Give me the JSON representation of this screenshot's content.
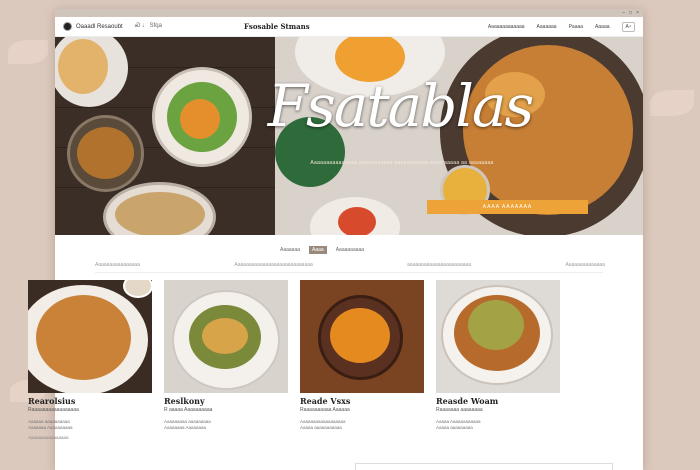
{
  "browser": {
    "controls": [
      "–",
      "□",
      "×"
    ]
  },
  "nav": {
    "brand": "Oaaadl Resaoubt",
    "brand_extra": "Ꮝ ♩ Sfqa",
    "title": "Fsosable Stmans",
    "links": [
      "Aaaaaaaaaaaaa",
      "Aaaaaaa",
      "Paaaa",
      "Aaaaa"
    ],
    "button": "A⁴"
  },
  "hero": {
    "title": "Fsatablas",
    "subtitle": "Aaaaaaaaaaaaaaa aaaaaaaaaaa aaaaaaaaaaa aaaa aaaaa aa aaaaaaaa",
    "cta": "AAAA   AAAAAAA"
  },
  "section": {
    "tabs": [
      "Aaaaaaa",
      "Aaaa",
      "Aaaaaaaaaa"
    ],
    "active_tab": 1,
    "tagline": [
      "Aaaaaaaaaaaaaaaa",
      "Aaaaaaaaaaaaaaaaaaaaaaaaaaaa",
      "aaaaaaaaaaaaaaaaaaaaaaa",
      "Aaaaaaaaaaaaaa"
    ]
  },
  "cards": [
    {
      "title": "Rearolsius",
      "sub": "Raaaaaaaaaaaaaaaaa",
      "desc": "Aaaaaa aaaaaaaaaa\nAaaaaaa Aaaaaaaaaa",
      "link": "Aaaaaaaaaaaaaaaa"
    },
    {
      "title": "Reslkony",
      "sub": "R aaaaa Aaaaaaaaaa",
      "desc": "Aaaaaaaaa aaaaaaaaa\nAaaaaaaa Aaaaaaaa",
      "link": ""
    },
    {
      "title": "Reade Vsxs",
      "sub": "Raaaaaaaaaa Aaaaaa",
      "desc": "Aaaaaaaaaaaaaaaaaa\nAaaaa aaaaaaaaaaa",
      "link": ""
    },
    {
      "title": "Reasde Woam",
      "sub": "Raaaaaaa aaaaaaaa",
      "desc": "Aaaaa Aaaaaaaaaaaa\nAaaaa aaaaaaaaa",
      "link": ""
    }
  ]
}
